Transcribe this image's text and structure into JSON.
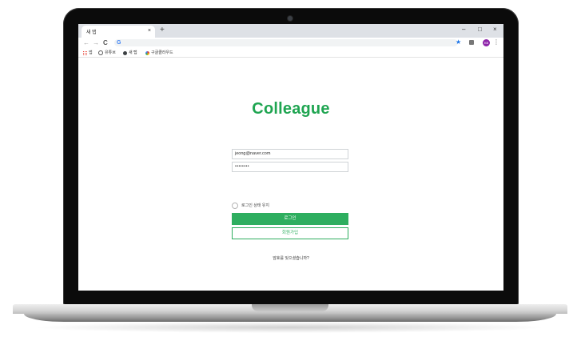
{
  "browser": {
    "tab_title": "새 탭",
    "tab_close": "×",
    "new_tab": "+",
    "window_controls": {
      "minimize": "–",
      "maximize": "□",
      "close": "×"
    },
    "nav": {
      "back": "←",
      "forward": "→",
      "reload": "C"
    },
    "omnibox_icon": "G",
    "star": "★",
    "avatar_initials": "KB",
    "menu": "⋮",
    "bookmarks": [
      {
        "label": "앱",
        "icon": "apps-icon"
      },
      {
        "label": "유튜브",
        "icon": "youtube-icon"
      },
      {
        "label": "새 탭",
        "icon": "globe-icon"
      },
      {
        "label": "구글클라우드",
        "icon": "google-cloud-icon"
      }
    ]
  },
  "page": {
    "brand": "Colleague",
    "email_value": "jeong@naver.com",
    "password_value": "••••••••",
    "remember_label": "로그인 상태 유지",
    "login_button": "로그인",
    "signup_button": "회원가입",
    "forgot_link": "암호를 잊으셨습니까?"
  },
  "colors": {
    "brand_green": "#1fa551",
    "button_green": "#2eae5f",
    "avatar_purple": "#8e24aa"
  }
}
